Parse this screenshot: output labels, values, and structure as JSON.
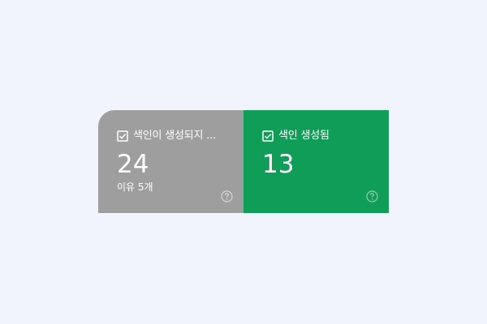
{
  "cards": [
    {
      "label": "색인이 생성되지 ...",
      "value": "24",
      "sub": "이유 5개",
      "checked": true,
      "color": "#9e9e9e",
      "help_icon": "help-circle-icon"
    },
    {
      "label": "색인 생성됨",
      "value": "13",
      "checked": true,
      "color": "#0f9d58",
      "help_icon": "help-circle-icon"
    }
  ],
  "background": "#f1f4fd"
}
